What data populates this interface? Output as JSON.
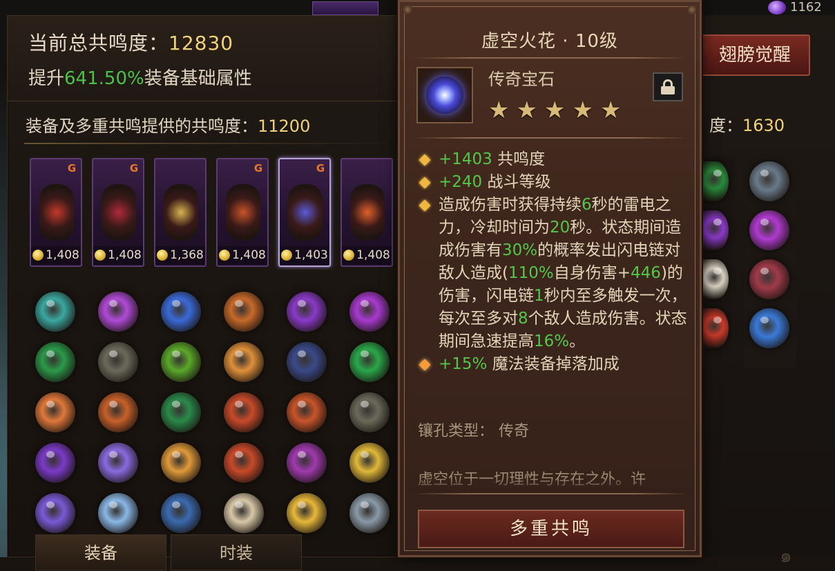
{
  "summary": {
    "total_label": "当前总共鸣度：",
    "total_value": "12830",
    "boost_prefix": "提升",
    "boost_pct": "641.50%",
    "boost_suffix": "装备基础属性"
  },
  "resonance_label": "装备及多重共鸣提供的共鸣度：",
  "resonance_value": "11200",
  "equipment": [
    {
      "score": "1,408",
      "has_rune": true,
      "color": "#c2392a"
    },
    {
      "score": "1,408",
      "has_rune": true,
      "color": "#b02a3a"
    },
    {
      "score": "1,368",
      "has_rune": false,
      "color": "#d8b450"
    },
    {
      "score": "1,408",
      "has_rune": true,
      "color": "#c8542a"
    },
    {
      "score": "1,403",
      "has_rune": true,
      "color": "#5a5ad8",
      "selected": true
    },
    {
      "score": "1,408",
      "has_rune": false,
      "color": "#e0602a"
    }
  ],
  "gems": [
    [
      "#3aa8a0",
      "#b04ad8",
      "#3a6ad8",
      "#c86a2a",
      "#8a3ac8",
      "#a83ad0"
    ],
    [
      "#2a9a4a",
      "#6a6a5a",
      "#5aa82a",
      "#e0903a",
      "#3a4a8a",
      "#2aa84a"
    ],
    [
      "#e0783a",
      "#c8602a",
      "#2a8a4a",
      "#c84a2a",
      "#c8542a",
      "#6a6a5a"
    ],
    [
      "#7a3ac8",
      "#8a6ae0",
      "#e09a3a",
      "#c84a2a",
      "#a03ab0",
      "#e0b83a"
    ],
    [
      "#7a5ad8",
      "#8ab8e8",
      "#3a6ab0",
      "#d8c8a8",
      "#e8b83a",
      "#8a9aa8"
    ]
  ],
  "bottom_tabs": [
    "装备",
    "时装"
  ],
  "right": {
    "wing_button": "翅膀觉醒",
    "resonance_label": "度：",
    "resonance_value": "1630",
    "top_value": "1162",
    "gems_col1": [
      "#2a8a3a",
      "#8a3ac8",
      "#d8d0c0",
      "#c83a2a"
    ],
    "gems_col2": [
      "#6a7a8a",
      "#b03ad0",
      "#a03a4a",
      "#3a7ad8"
    ]
  },
  "tooltip": {
    "title": "虚空火花 · 10级",
    "type": "传奇宝石",
    "stars": "★★★★★",
    "star_count": 5,
    "stats": [
      {
        "prefix": "+1403",
        "text": " 共鸣度"
      },
      {
        "prefix": "+240",
        "text": " 战斗等级"
      }
    ],
    "effect": {
      "t1": "造成伤害时获得持续",
      "v1": "6",
      "t2": "秒的雷电之力，冷却时间为",
      "v2": "20",
      "t3": "秒。状态期间造成伤害有",
      "v3": "30%",
      "t4": "的概率发出闪电链对敌人造成(",
      "v4": "110%",
      "t5": "自身伤害+",
      "v5": "446",
      "t6": ")的伤害，闪电链",
      "v6": "1",
      "t7": "秒内至多触发一次，每次至多对",
      "v7": "8",
      "t8": "个敌人造成伤害。状态期间急速提高",
      "v8": "16%",
      "t9": "。"
    },
    "bonus": {
      "prefix": "+15%",
      "text": " 魔法装备掉落加成"
    },
    "socket": "镶孔类型：  传奇",
    "lore": "虚空位于一切理性与存在之外。许",
    "button": "多重共鸣"
  }
}
